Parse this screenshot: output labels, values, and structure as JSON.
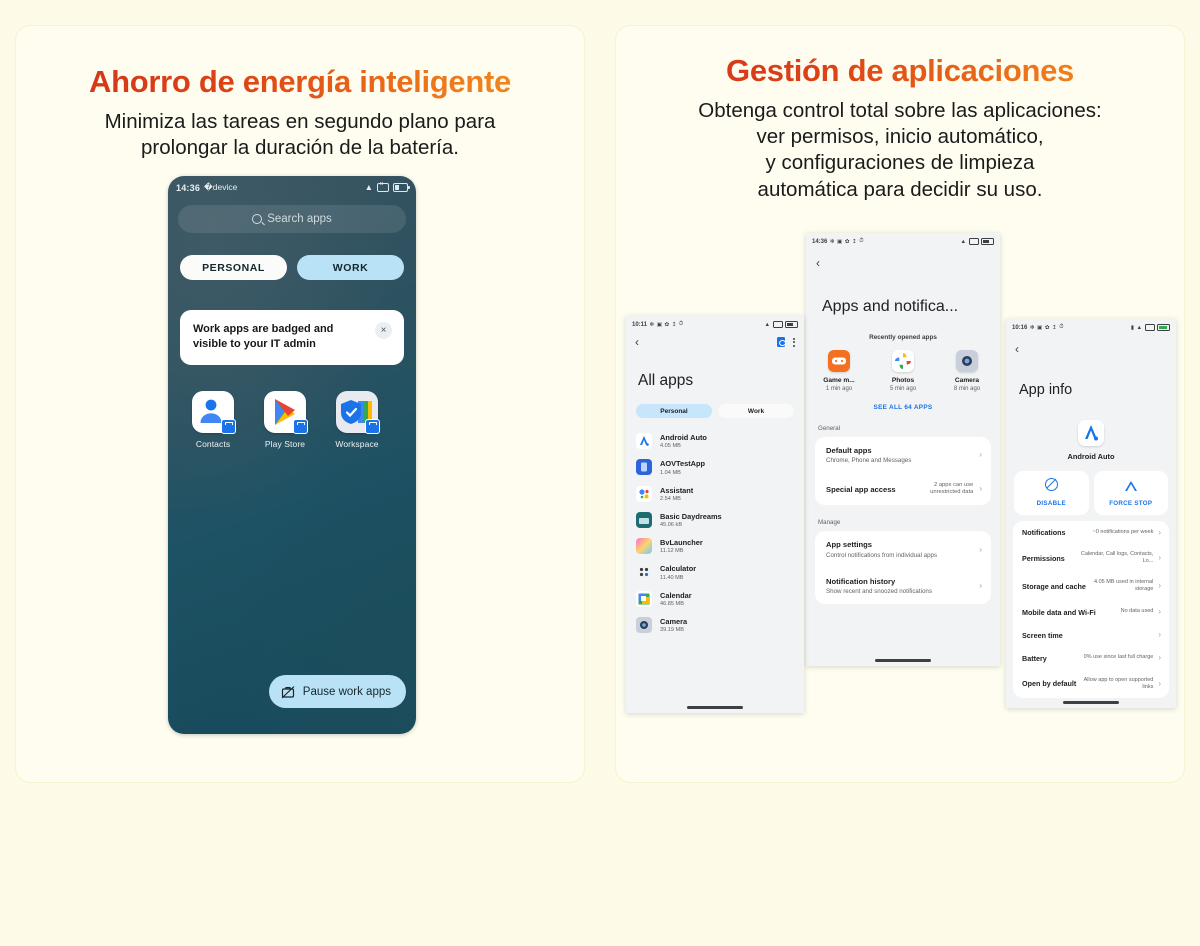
{
  "left_panel": {
    "heading": "Ahorro de energía inteligente",
    "subtext_lines": [
      "Minimiza las tareas en segundo plano para",
      "prolongar la duración de la batería."
    ],
    "phone": {
      "status_bar": {
        "time": "14:36",
        "icons": [
          "bluetooth-icon",
          "vibrate-icon",
          "gear-icon",
          "download-icon",
          "alarm-icon"
        ],
        "right_icons": [
          "wifi-icon",
          "no-sim-icon",
          "battery-icon"
        ]
      },
      "search_placeholder": "Search apps",
      "tabs": [
        {
          "label": "PERSONAL",
          "selected": false
        },
        {
          "label": "WORK",
          "selected": true
        }
      ],
      "notice": {
        "line1": "Work apps are badged and",
        "line2": "visible to your IT admin",
        "close": "×"
      },
      "apps": [
        {
          "label": "Contacts",
          "icon": "contacts-icon"
        },
        {
          "label": "Play Store",
          "icon": "play-store-icon"
        },
        {
          "label": "Workspace",
          "icon": "google-workspace-icon"
        }
      ],
      "pause_button": "Pause work apps"
    }
  },
  "right_panel": {
    "heading": "Gestión de aplicaciones",
    "subtext_lines": [
      "Obtenga control total sobre las aplicaciones:",
      "ver permisos, inicio automático,",
      "y configuraciones de limpieza",
      "automática para decidir su uso."
    ],
    "phone_all_apps": {
      "status_time": "10:11",
      "title": "All apps",
      "segments": [
        {
          "label": "Personal",
          "selected": true
        },
        {
          "label": "Work",
          "selected": false
        }
      ],
      "apps": [
        {
          "name": "Android Auto",
          "size": "4.05 MB"
        },
        {
          "name": "AOVTestApp",
          "size": "1.04 MB"
        },
        {
          "name": "Assistant",
          "size": "2.54 MB"
        },
        {
          "name": "Basic Daydreams",
          "size": "45.06 kB"
        },
        {
          "name": "BvLauncher",
          "size": "11.12 MB"
        },
        {
          "name": "Calculator",
          "size": "11.40 MB"
        },
        {
          "name": "Calendar",
          "size": "46.85 MB"
        },
        {
          "name": "Camera",
          "size": "39.19 MB"
        }
      ]
    },
    "phone_apps_notifications": {
      "status_time": "14:36",
      "title": "Apps and notifica...",
      "recent_caption": "Recently opened apps",
      "recent_apps": [
        {
          "name": "Game m...",
          "time": "1 min ago"
        },
        {
          "name": "Photos",
          "time": "5 min ago"
        },
        {
          "name": "Camera",
          "time": "8 min ago"
        }
      ],
      "see_all": "SEE ALL 64 APPS",
      "sections": [
        {
          "label": "General",
          "rows": [
            {
              "title": "Default apps",
              "subtitle": "Chrome, Phone and Messages",
              "value": ""
            },
            {
              "title": "Special app access",
              "subtitle": "",
              "value": "2 apps can use unrestricted data"
            }
          ]
        },
        {
          "label": "Manage",
          "rows": [
            {
              "title": "App settings",
              "subtitle": "Control notifications from individual apps",
              "value": ""
            },
            {
              "title": "Notification history",
              "subtitle": "Show recent and snoozed notifications",
              "value": ""
            }
          ]
        }
      ]
    },
    "phone_app_info": {
      "status_time": "10:16",
      "title": "App info",
      "app_name": "Android Auto",
      "actions": [
        {
          "label": "DISABLE",
          "icon": "disable-icon"
        },
        {
          "label": "FORCE STOP",
          "icon": "force-stop-icon"
        }
      ],
      "rows": [
        {
          "title": "Notifications",
          "value": "~0 notifications per week"
        },
        {
          "title": "Permissions",
          "value": "Calendar, Call logs, Contacts, Lo..."
        },
        {
          "title": "Storage and cache",
          "value": "4.05 MB used in internal storage"
        },
        {
          "title": "Mobile data and Wi-Fi",
          "value": "No data used"
        },
        {
          "title": "Screen time",
          "value": ""
        },
        {
          "title": "Battery",
          "value": "0% use since last full charge"
        },
        {
          "title": "Open by default",
          "value": "Allow app to open supported links"
        }
      ]
    }
  },
  "colors": {
    "page_background": "#fdfbe8",
    "panel_background": "#fefdf0",
    "heading_gradient_start": "#d2331a",
    "heading_gradient_end": "#f4921f",
    "accent_blue": "#1a73e8",
    "work_tab": "#b9e2f7"
  }
}
